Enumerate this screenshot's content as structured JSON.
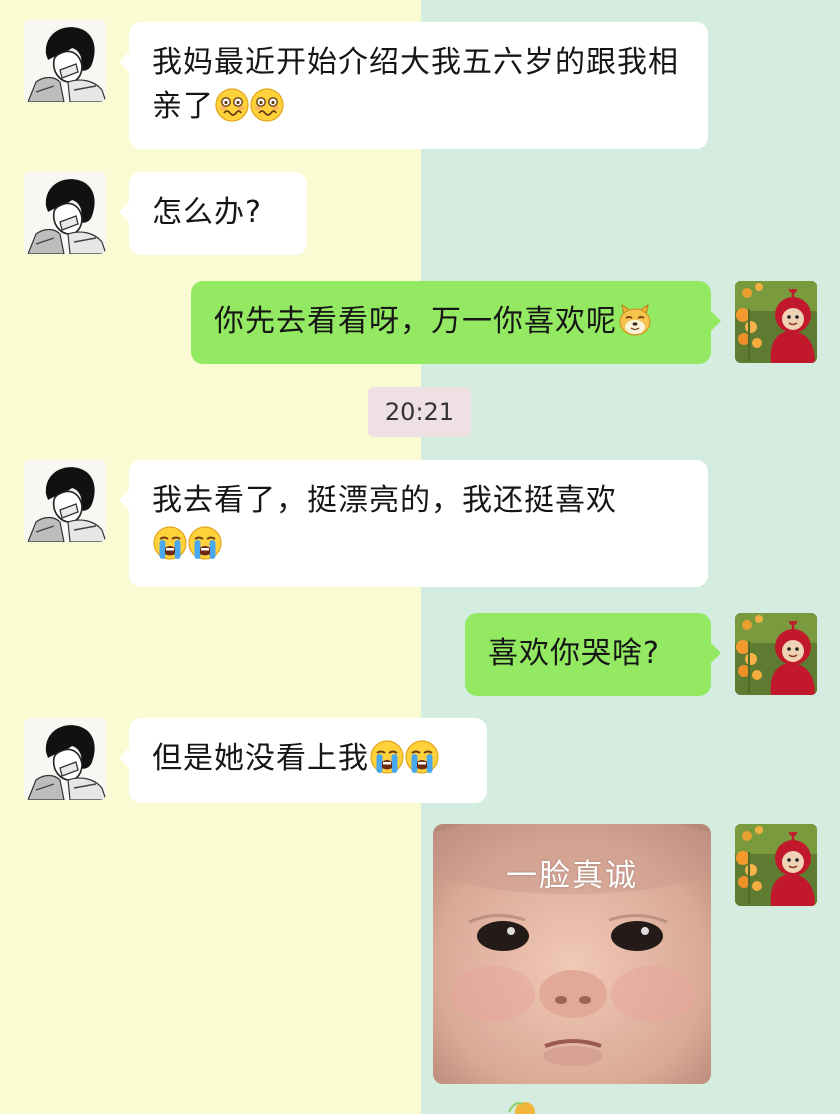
{
  "chat": {
    "messages": [
      {
        "side": "left",
        "text": "我妈最近开始介绍大我五六岁的跟我相亲了",
        "emojis": [
          "woozy-face-icon",
          "woozy-face-icon"
        ]
      },
      {
        "side": "left",
        "text": "怎么办?",
        "emojis": []
      },
      {
        "side": "right",
        "text": "你先去看看呀，万一你喜欢呢",
        "emojis": [
          "doge-icon"
        ]
      },
      {
        "side": "left",
        "text": "我去看了，挺漂亮的，我还挺喜欢",
        "emojis": [
          "loudly-crying-face-icon",
          "loudly-crying-face-icon"
        ]
      },
      {
        "side": "right",
        "text": "喜欢你哭啥?",
        "emojis": []
      },
      {
        "side": "left",
        "text": "但是她没看上我",
        "emojis": [
          "loudly-crying-face-icon",
          "loudly-crying-face-icon"
        ]
      },
      {
        "side": "right",
        "sticker_caption": "一脸真诚"
      }
    ],
    "timestamp": "20:21"
  },
  "colors": {
    "left_background": "#fbfbd3",
    "right_background": "#d5ede1",
    "incoming_bubble": "#ffffff",
    "outgoing_bubble": "#94e962",
    "timestamp_pill": "#efe1e3"
  }
}
